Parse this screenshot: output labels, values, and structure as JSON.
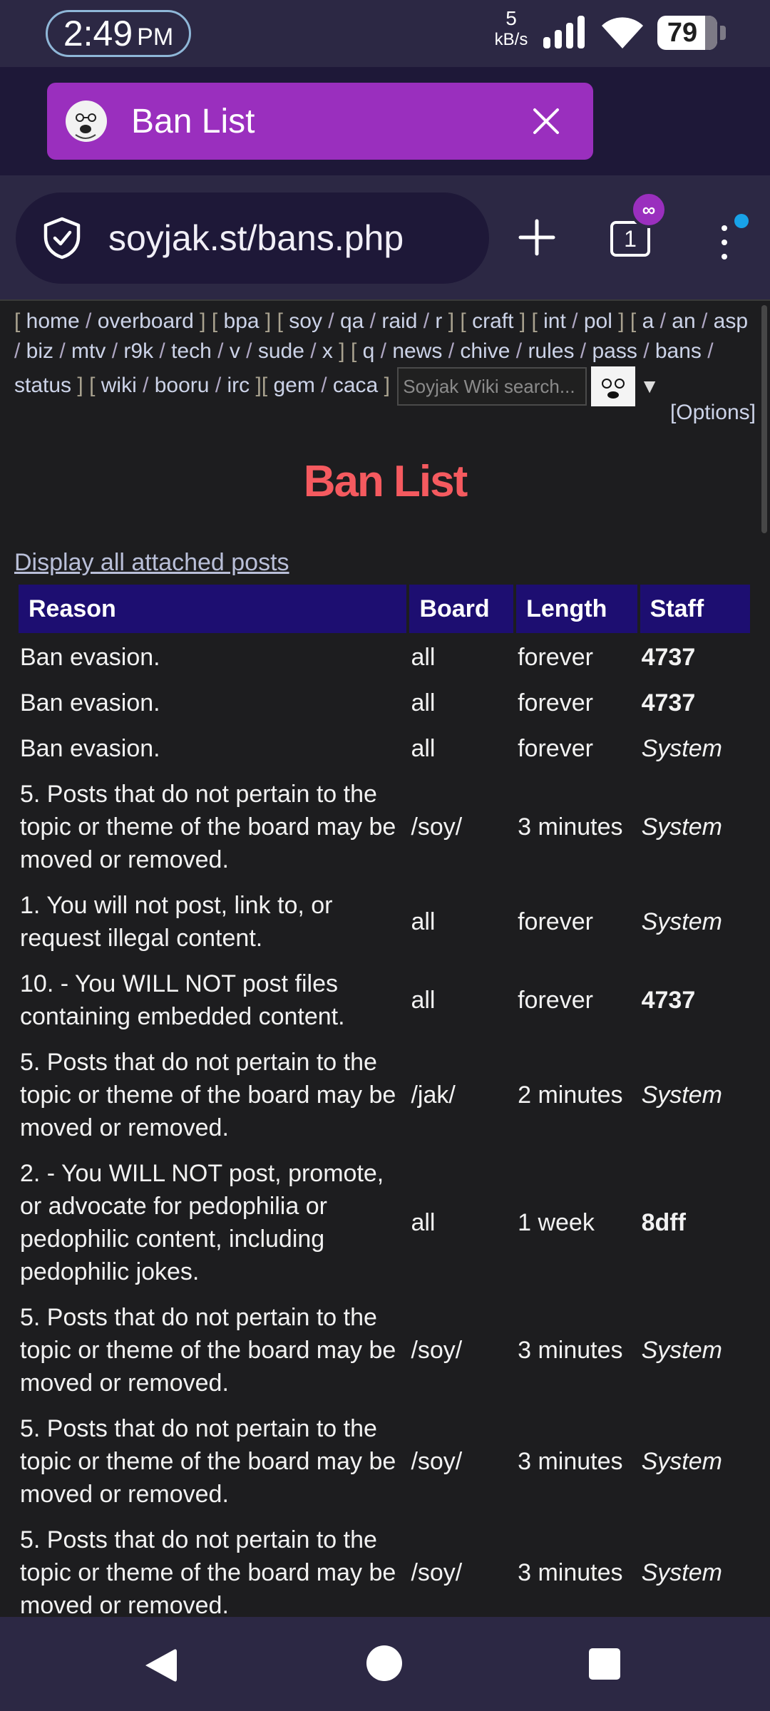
{
  "status_bar": {
    "time": "2:49",
    "ampm": "PM",
    "net_speed_value": "5",
    "net_speed_unit": "kB/s",
    "battery": "79"
  },
  "tab": {
    "title": "Ban List",
    "favicon": "soyjak-face-icon",
    "close_icon": "close-icon"
  },
  "address_bar": {
    "url": "soyjak.st/bans.php",
    "tab_count": "1",
    "private_badge": "∞"
  },
  "board_nav": {
    "groups": [
      [
        "home",
        "overboard"
      ],
      [
        "bpa"
      ],
      [
        "soy",
        "qa",
        "raid",
        "r"
      ],
      [
        "craft"
      ],
      [
        "int",
        "pol"
      ],
      [
        "a",
        "an",
        "asp",
        "biz",
        "mtv",
        "r9k",
        "tech",
        "v",
        "sude",
        "x"
      ],
      [
        "q",
        "news",
        "chive",
        "rules",
        "pass",
        "bans",
        "status"
      ],
      [
        "wiki",
        "booru",
        "irc"
      ],
      [
        "gem",
        "caca"
      ]
    ],
    "search_placeholder": "Soyjak Wiki search...",
    "options_label": "[Options]"
  },
  "page": {
    "title": "Ban List",
    "display_all_link": "Display all attached posts"
  },
  "table": {
    "headers": [
      "Reason",
      "Board",
      "Length",
      "Staff"
    ],
    "rows": [
      {
        "reason": "Ban evasion.",
        "board": "all",
        "length": "forever",
        "staff": "4737",
        "staff_type": "mod"
      },
      {
        "reason": "Ban evasion.",
        "board": "all",
        "length": "forever",
        "staff": "4737",
        "staff_type": "mod"
      },
      {
        "reason": "Ban evasion.",
        "board": "all",
        "length": "forever",
        "staff": "System",
        "staff_type": "system"
      },
      {
        "reason": "5. Posts that do not pertain to the topic or theme of the board may be moved or removed.",
        "board": "/soy/",
        "length": "3 minutes",
        "staff": "System",
        "staff_type": "system"
      },
      {
        "reason": "1. You will not post, link to, or request illegal content.",
        "board": "all",
        "length": "forever",
        "staff": "System",
        "staff_type": "system"
      },
      {
        "reason": "10. - You WILL NOT post files containing embedded content.",
        "board": "all",
        "length": "forever",
        "staff": "4737",
        "staff_type": "mod"
      },
      {
        "reason": "5. Posts that do not pertain to the topic or theme of the board may be moved or removed.",
        "board": "/jak/",
        "length": "2 minutes",
        "staff": "System",
        "staff_type": "system"
      },
      {
        "reason": "2. - You WILL NOT post, promote, or advocate for pedophilia or pedophilic content, including pedophilic jokes.",
        "board": "all",
        "length": "1 week",
        "staff": "8dff",
        "staff_type": "mod"
      },
      {
        "reason": "5. Posts that do not pertain to the topic or theme of the board may be moved or removed.",
        "board": "/soy/",
        "length": "3 minutes",
        "staff": "System",
        "staff_type": "system"
      },
      {
        "reason": "5. Posts that do not pertain to the topic or theme of the board may be moved or removed.",
        "board": "/soy/",
        "length": "3 minutes",
        "staff": "System",
        "staff_type": "system"
      },
      {
        "reason": "5. Posts that do not pertain to the topic or theme of the board may be moved or removed.",
        "board": "/soy/",
        "length": "3 minutes",
        "staff": "System",
        "staff_type": "system"
      }
    ]
  },
  "colors": {
    "title_red": "#f55a5f",
    "header_navy": "#1d0e71",
    "mod_pink": "#f06bf0",
    "tab_purple": "#9a2fbe"
  }
}
